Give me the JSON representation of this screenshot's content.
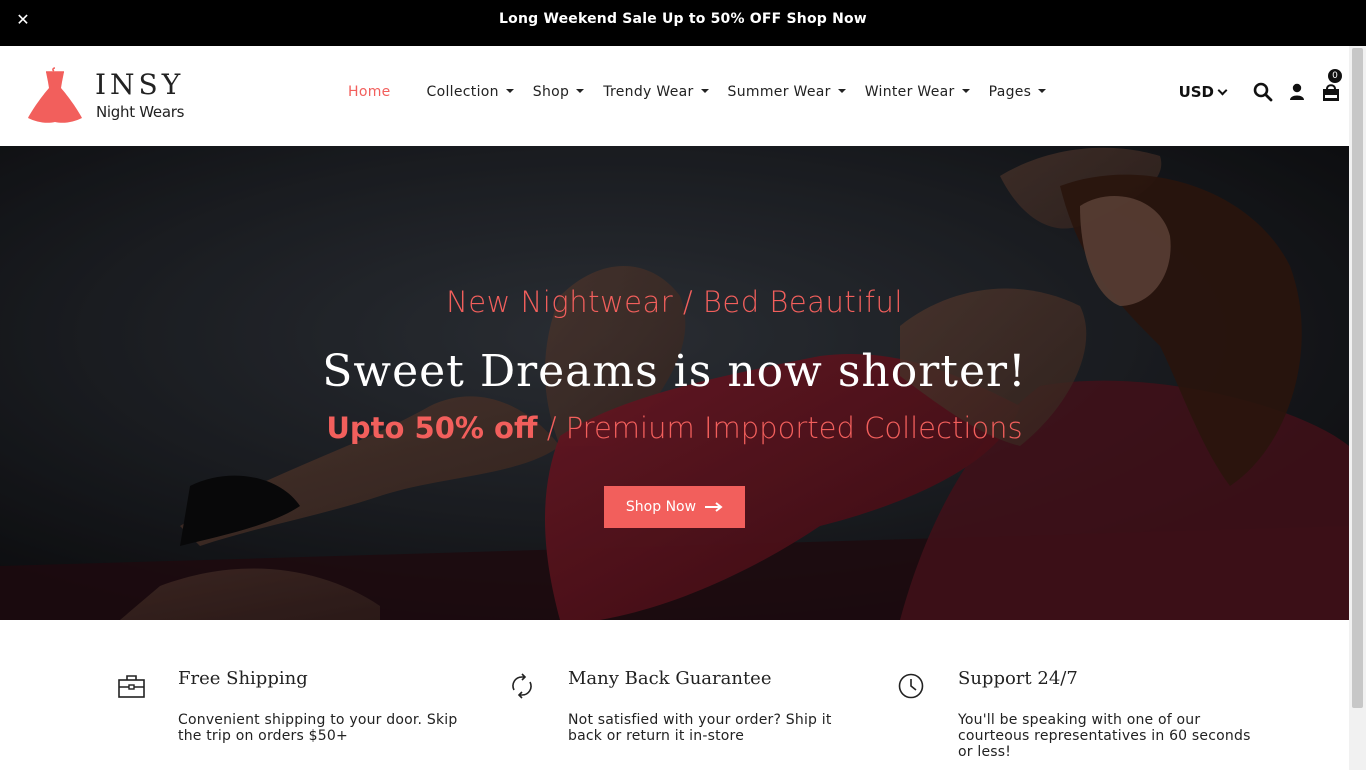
{
  "announcement": {
    "close_label": "✕",
    "message": "Long Weekend Sale Up to 50% OFF Shop Now"
  },
  "brand": {
    "name": "INSY",
    "tagline": "Night Wears",
    "accent": "#f25f5c"
  },
  "nav": {
    "items": [
      {
        "label": "Home",
        "active": true
      },
      {
        "label": "Collection"
      },
      {
        "label": "Shop"
      },
      {
        "label": "Trendy Wear"
      },
      {
        "label": "Summer Wear"
      },
      {
        "label": "Winter Wear"
      },
      {
        "label": "Pages"
      }
    ]
  },
  "header_right": {
    "currency": "USD",
    "icons": [
      "search-icon",
      "user-icon",
      "cart-icon"
    ],
    "cart_count": "0"
  },
  "hero": {
    "subtitle": "New Nightwear / Bed Beautiful",
    "title": "Sweet Dreams is now shorter!",
    "offer_strong": "Upto 50% off",
    "offer_rest": " / Premium Impported Collections",
    "button_label": "Shop Now",
    "button_icon": "arrow-right-icon"
  },
  "features": [
    {
      "icon": "briefcase-icon",
      "title": "Free Shipping",
      "desc": "Convenient shipping to your door. Skip the trip on orders $50+"
    },
    {
      "icon": "refresh-icon",
      "title": "Many Back Guarantee",
      "desc": "Not satisfied with your order? Ship it back or return it in-store"
    },
    {
      "icon": "clock-icon",
      "title": "Support 24/7",
      "desc": "You'll be speaking with one of our courteous representatives in 60 seconds or less!"
    }
  ]
}
